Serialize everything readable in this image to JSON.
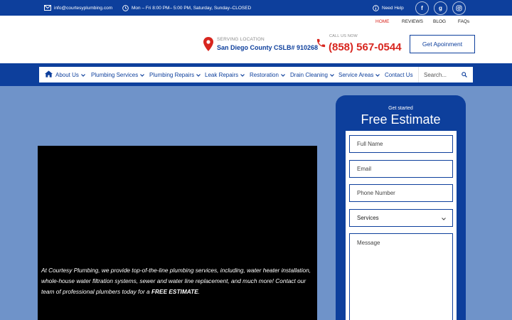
{
  "topbar": {
    "email": "info@courtesyplumbing.com",
    "hours": "Mon – Fri 8:00 PM– 5:00 PM, Saturday, Sunday–CLOSED",
    "help": "Need Help",
    "social": {
      "facebook": "f",
      "google": "g",
      "instagram": ""
    }
  },
  "secondary_nav": [
    "HOME",
    "REVIEWS",
    "BLOG",
    "FAQs"
  ],
  "header": {
    "location_label": "SERVING LOCATION",
    "location_value": "San Diego County CSLB# 910268",
    "call_label": "CALL US NOW",
    "call_value": "(858) 567-0544",
    "appointment_button": "Get Apoinment"
  },
  "nav": {
    "items": [
      "About Us",
      "Plumbing Services",
      "Plumbing Repairs",
      "Leak Repairs",
      "Restoration",
      "Drain Cleaning",
      "Service Areas",
      "Contact Us"
    ],
    "search_placeholder": "Search..."
  },
  "video": {
    "text_plain": "At Courtesy Plumbing, we provide top-of-the-line plumbing services, including, water heater installation, whole-house water filtration systems, sewer and water line replacement, and much more! Contact our team of professional plumbers today for a ",
    "text_bold": "FREE ESTIMATE",
    "text_end": "."
  },
  "form": {
    "kicker": "Get started",
    "title": "Free Estimate",
    "full_name": "Full Name",
    "email": "Email",
    "phone": "Phone Number",
    "services": "Services",
    "message": "Message"
  },
  "colors": {
    "brand_blue": "#0d3f9c",
    "accent_red": "#d8261f",
    "hero_bg": "#6f93c9"
  }
}
